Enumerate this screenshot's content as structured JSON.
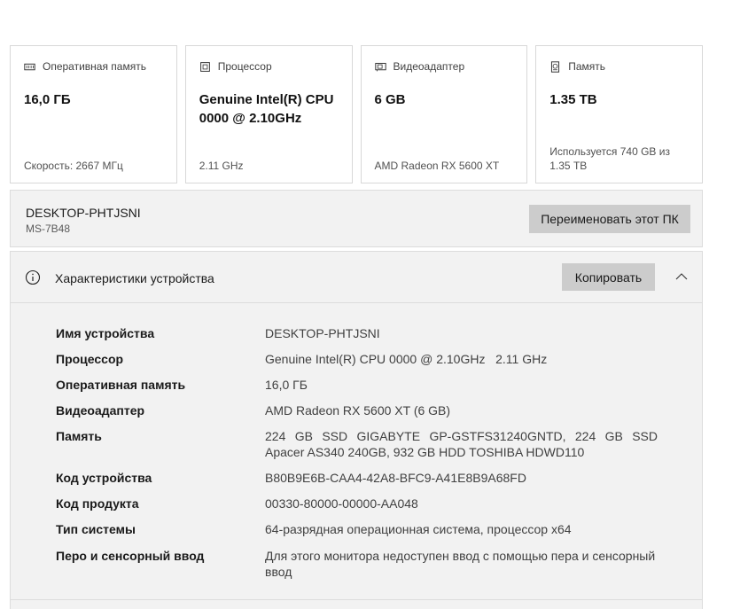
{
  "cards": [
    {
      "title": "Оперативная память",
      "value": "16,0 ГБ",
      "footer": "Скорость: 2667 МГц",
      "icon": "memory-icon"
    },
    {
      "title": "Процессор",
      "value": "Genuine Intel(R) CPU 0000 @ 2.10GHz",
      "footer": "2.11 GHz",
      "icon": "processor-icon"
    },
    {
      "title": "Видеоадаптер",
      "value": "6 GB",
      "footer": "AMD Radeon RX 5600 XT",
      "icon": "gpu-icon"
    },
    {
      "title": "Память",
      "value": "1.35 TB",
      "footer": "Используется 740 GB из 1.35 TB",
      "icon": "storage-icon"
    }
  ],
  "device": {
    "name": "DESKTOP-PHTJSNI",
    "model": "MS-7B48",
    "rename_label": "Переименовать этот ПК"
  },
  "specs": {
    "title": "Характеристики устройства",
    "copy_label": "Копировать",
    "rows": [
      {
        "label": "Имя устройства",
        "value": "DESKTOP-PHTJSNI"
      },
      {
        "label": "Процессор",
        "value": "Genuine Intel(R) CPU 0000 @ 2.10GHz   2.11 GHz"
      },
      {
        "label": "Оперативная память",
        "value": "16,0 ГБ"
      },
      {
        "label": "Видеоадаптер",
        "value": "AMD Radeon RX 5600 XT (6 GB)"
      },
      {
        "label": "Память",
        "value": "224 GB SSD GIGABYTE GP-GSTFS31240GNTD, 224 GB SSD Apacer AS340 240GB, 932 GB HDD TOSHIBA HDWD110"
      },
      {
        "label": "Код устройства",
        "value": "B80B9E6B-CAA4-42A8-BFC9-A41E8B9A68FD"
      },
      {
        "label": "Код продукта",
        "value": "00330-80000-00000-AA048"
      },
      {
        "label": "Тип системы",
        "value": "64-разрядная операционная система, процессор x64"
      },
      {
        "label": "Перо и сенсорный ввод",
        "value": "Для этого монитора недоступен ввод с помощью пера и сенсорный ввод"
      }
    ]
  }
}
